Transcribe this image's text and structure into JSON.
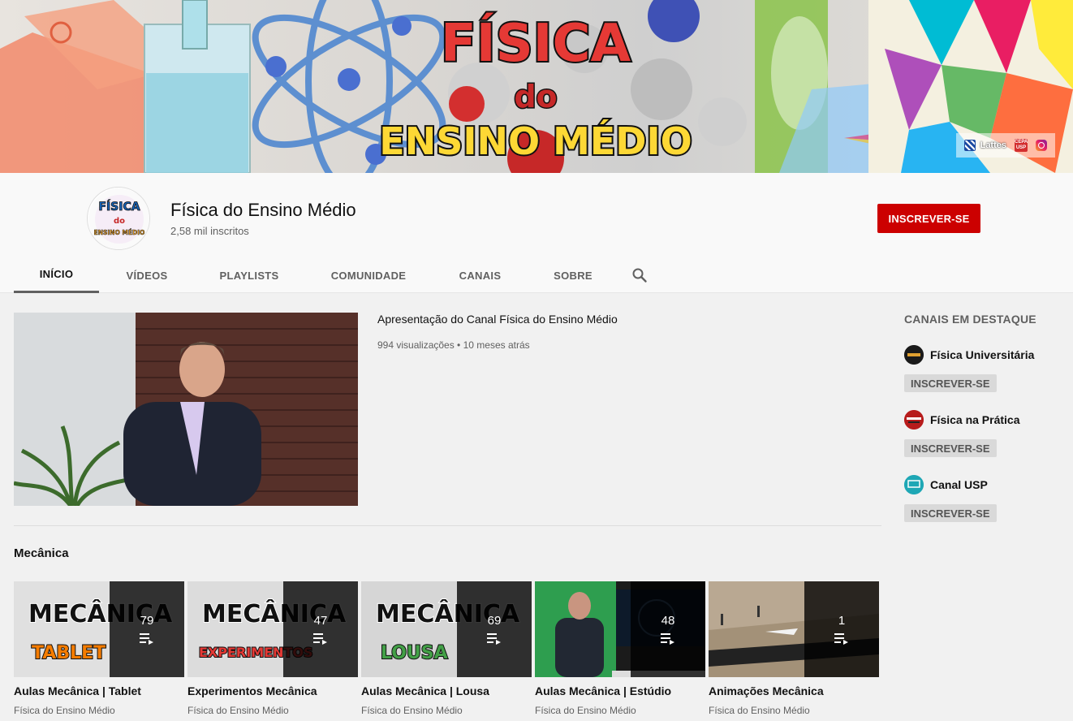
{
  "banner": {
    "title_line1": "FÍSICA",
    "title_line2": "do",
    "title_line3": "ENSINO MÉDIO",
    "links": [
      {
        "label": "Lattes",
        "icon": "lattes-icon"
      },
      {
        "label": "",
        "icon": "cepa-usp-icon"
      },
      {
        "label": "",
        "icon": "instagram-icon"
      }
    ],
    "cepa_icon_text": "CEPA",
    "cepa_icon_sub": "USP"
  },
  "channel": {
    "name": "Física do Ensino Médio",
    "subscribers": "2,58 mil inscritos",
    "subscribe_label": "INSCREVER-SE",
    "avatar_text_top": "FÍSICA",
    "avatar_text_mid": "do",
    "avatar_text_bottom": "ENSINO MÉDIO"
  },
  "tabs": [
    {
      "label": "INÍCIO",
      "active": true
    },
    {
      "label": "VÍDEOS",
      "active": false
    },
    {
      "label": "PLAYLISTS",
      "active": false
    },
    {
      "label": "COMUNIDADE",
      "active": false
    },
    {
      "label": "CANAIS",
      "active": false
    },
    {
      "label": "SOBRE",
      "active": false
    }
  ],
  "featured": {
    "title": "Apresentação do Canal Física do Ensino Médio",
    "meta": "994 visualizações • 10 meses atrás"
  },
  "shelf": {
    "title": "Mecânica",
    "playlists": [
      {
        "title": "Aulas Mecânica | Tablet",
        "channel": "Física do Ensino Médio",
        "count": "79",
        "thumb_main": "MECÂNICA",
        "thumb_sub": "TABLET",
        "sub_color": "#f57c00"
      },
      {
        "title": "Experimentos Mecânica",
        "channel": "Física do Ensino Médio",
        "count": "47",
        "thumb_main": "MECÂNICA",
        "thumb_sub": "EXPERIMENTOS",
        "sub_color": "#e53935"
      },
      {
        "title": "Aulas Mecânica | Lousa",
        "channel": "Física do Ensino Médio",
        "count": "69",
        "thumb_main": "MECÂNICA",
        "thumb_sub": "LOUSA",
        "sub_color": "#43a047"
      },
      {
        "title": "Aulas Mecânica | Estúdio",
        "channel": "Física do Ensino Médio",
        "count": "48",
        "thumb_main": "",
        "thumb_sub": "",
        "sub_color": ""
      },
      {
        "title": "Animações Mecânica",
        "channel": "Física do Ensino Médio",
        "count": "1",
        "thumb_main": "",
        "thumb_sub": "",
        "sub_color": ""
      }
    ]
  },
  "sidebar": {
    "heading": "CANAIS EM DESTAQUE",
    "channels": [
      {
        "name": "Física Universitária",
        "subscribe_label": "INSCREVER-SE",
        "avatar_color": "#1a1a1a"
      },
      {
        "name": "Física na Prática",
        "subscribe_label": "INSCREVER-SE",
        "avatar_color": "#b71c1c"
      },
      {
        "name": "Canal USP",
        "subscribe_label": "INSCREVER-SE",
        "avatar_color": "#1ea7b5"
      }
    ]
  },
  "colors": {
    "subscribe_red": "#cc0000",
    "text_primary": "#111111",
    "text_secondary": "#606060",
    "page_bg": "#f1f1f1"
  }
}
